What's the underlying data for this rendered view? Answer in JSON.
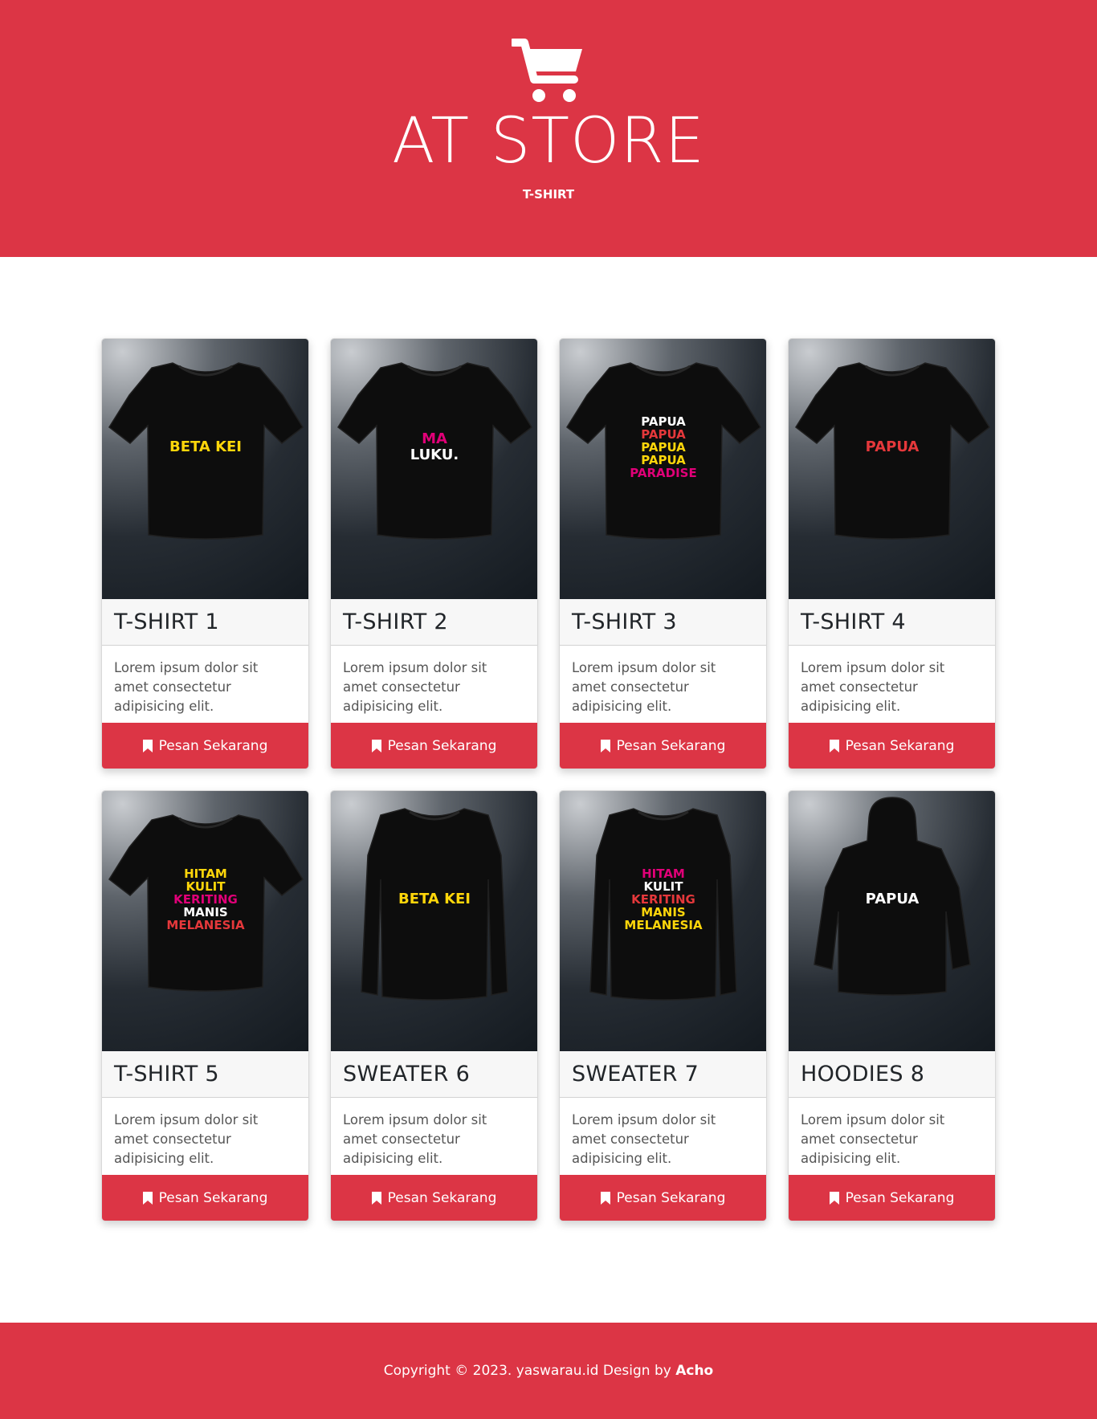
{
  "header": {
    "icon": "cart-icon",
    "title": "AT STORE",
    "subtitle": "T-SHIRT"
  },
  "products": [
    {
      "title": "T-SHIRT 1",
      "description": "Lorem ipsum dolor sit amet consectetur adipisicing elit.",
      "button": "Pesan Sekarang",
      "garment": "tshirt",
      "print": [
        "BETA KEI"
      ]
    },
    {
      "title": "T-SHIRT 2",
      "description": "Lorem ipsum dolor sit amet consectetur adipisicing elit.",
      "button": "Pesan Sekarang",
      "garment": "tshirt",
      "print": [
        "MA",
        "LUKU."
      ]
    },
    {
      "title": "T-SHIRT 3",
      "description": "Lorem ipsum dolor sit amet consectetur adipisicing elit.",
      "button": "Pesan Sekarang",
      "garment": "tshirt",
      "print": [
        "PAPUA",
        "PAPUA",
        "PAPUA",
        "PAPUA",
        "PARADISE"
      ]
    },
    {
      "title": "T-SHIRT 4",
      "description": "Lorem ipsum dolor sit amet consectetur adipisicing elit.",
      "button": "Pesan Sekarang",
      "garment": "tshirt",
      "print": [
        "PAPUA"
      ]
    },
    {
      "title": "T-SHIRT 5",
      "description": "Lorem ipsum dolor sit amet consectetur adipisicing elit.",
      "button": "Pesan Sekarang",
      "garment": "tshirt",
      "print": [
        "HITAM",
        "KULIT",
        "KERITING",
        "MANIS",
        "MELANESIA"
      ]
    },
    {
      "title": "SWEATER 6",
      "description": "Lorem ipsum dolor sit amet consectetur adipisicing elit.",
      "button": "Pesan Sekarang",
      "garment": "sweater",
      "print": [
        "BETA KEI"
      ]
    },
    {
      "title": "SWEATER 7",
      "description": "Lorem ipsum dolor sit amet consectetur adipisicing elit.",
      "button": "Pesan Sekarang",
      "garment": "sweater",
      "print": [
        "HITAM",
        "KULIT",
        "KERITING",
        "MANIS",
        "MELANESIA"
      ]
    },
    {
      "title": "HOODIES 8",
      "description": "Lorem ipsum dolor sit amet consectetur adipisicing elit.",
      "button": "Pesan Sekarang",
      "garment": "hoodie",
      "print": [
        "PAPUA"
      ]
    }
  ],
  "footer": {
    "text": "Copyright © 2023. yaswarau.id Design by",
    "author": "Acho"
  },
  "colors": {
    "primary": "#dc3545",
    "card_header_bg": "#f7f7f7",
    "image_bg_dark": "#141a20"
  }
}
